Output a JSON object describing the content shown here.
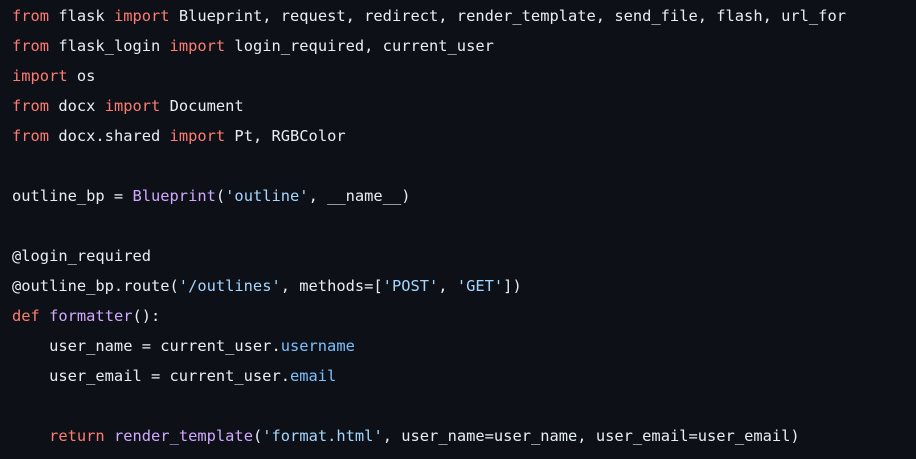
{
  "code_lines": [
    [
      [
        "kw",
        "from"
      ],
      [
        "plain",
        " flask "
      ],
      [
        "kw",
        "import"
      ],
      [
        "plain",
        " Blueprint, request, redirect, render_template, send_file, flash, url_for"
      ]
    ],
    [
      [
        "kw",
        "from"
      ],
      [
        "plain",
        " flask_login "
      ],
      [
        "kw",
        "import"
      ],
      [
        "plain",
        " login_required, current_user"
      ]
    ],
    [
      [
        "kw",
        "import"
      ],
      [
        "plain",
        " os"
      ]
    ],
    [
      [
        "kw",
        "from"
      ],
      [
        "plain",
        " docx "
      ],
      [
        "kw",
        "import"
      ],
      [
        "plain",
        " Document"
      ]
    ],
    [
      [
        "kw",
        "from"
      ],
      [
        "plain",
        " docx.shared "
      ],
      [
        "kw",
        "import"
      ],
      [
        "plain",
        " Pt, RGBColor"
      ]
    ],
    [],
    [
      [
        "plain",
        "outline_bp = "
      ],
      [
        "fn",
        "Blueprint"
      ],
      [
        "plain",
        "("
      ],
      [
        "str",
        "'outline'"
      ],
      [
        "plain",
        ", __name__)"
      ]
    ],
    [],
    [
      [
        "plain",
        "@login_required"
      ]
    ],
    [
      [
        "plain",
        "@outline_bp.route("
      ],
      [
        "str",
        "'/outlines'"
      ],
      [
        "plain",
        ", methods=["
      ],
      [
        "str",
        "'POST'"
      ],
      [
        "plain",
        ", "
      ],
      [
        "str",
        "'GET'"
      ],
      [
        "plain",
        "])"
      ]
    ],
    [
      [
        "kw",
        "def"
      ],
      [
        "plain",
        " "
      ],
      [
        "fn",
        "formatter"
      ],
      [
        "plain",
        "():"
      ]
    ],
    [
      [
        "plain",
        "    user_name = current_user."
      ],
      [
        "attr",
        "username"
      ]
    ],
    [
      [
        "plain",
        "    user_email = current_user."
      ],
      [
        "attr",
        "email"
      ]
    ],
    [],
    [
      [
        "plain",
        "    "
      ],
      [
        "kw",
        "return"
      ],
      [
        "plain",
        " "
      ],
      [
        "fn",
        "render_template"
      ],
      [
        "plain",
        "("
      ],
      [
        "str",
        "'format.html'"
      ],
      [
        "plain",
        ", user_name=user_name, user_email=user_email)"
      ]
    ]
  ],
  "colors": {
    "background": "#0d1117",
    "keyword": "#ff7b72",
    "function": "#d2a8ff",
    "string": "#a5d6ff",
    "attribute": "#79c0ff",
    "text": "#e6edf3"
  }
}
